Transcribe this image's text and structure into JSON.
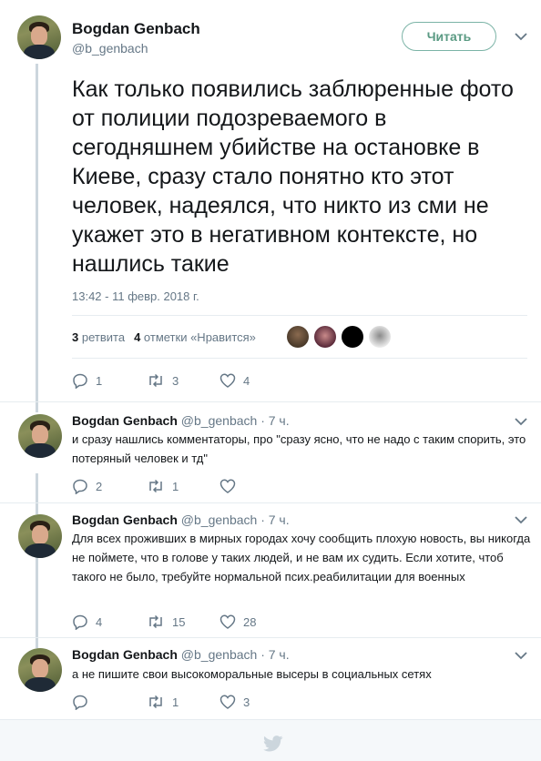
{
  "main_tweet": {
    "name": "Bogdan Genbach",
    "handle": "@b_genbach",
    "follow_label": "Читать",
    "text": "Как только появились заблюренные фото от полиции подозреваемого в сегодняшнем убийстве на остановке в Киеве, сразу стало понятно кто этот человек, надеялся, что никто из сми не укажет это в негативном контексте, но нашлись такие",
    "timestamp": "13:42 - 11 февр. 2018 г.",
    "retweets_count": "3",
    "retweets_label": "ретвита",
    "likes_count": "4",
    "likes_label": "отметки «Нравится»",
    "actions": {
      "replies": "1",
      "retweets": "3",
      "likes": "4"
    }
  },
  "replies": [
    {
      "name": "Bogdan Genbach",
      "handle": "@b_genbach",
      "time": "· 7 ч.",
      "text": "и сразу нашлись комментаторы, про \"сразу ясно, что не надо с таким спорить, это потеряный человек и тд\"",
      "replies": "2",
      "retweets": "1",
      "likes": ""
    },
    {
      "name": "Bogdan Genbach",
      "handle": "@b_genbach",
      "time": "· 7 ч.",
      "text": "Для всех проживших в мирных городах хочу сообщить плохую новость, вы никогда не поймете, что в голове у таких людей, и не вам их судить. Если хотите, чтоб такого не было, требуйте нормальной псих.реабилитации для военных",
      "replies": "4",
      "retweets": "15",
      "likes": "28"
    },
    {
      "name": "Bogdan Genbach",
      "handle": "@b_genbach",
      "time": "· 7 ч.",
      "text": "а не пишите свои высокоморальные высеры в социальных сетях",
      "replies": "",
      "retweets": "1",
      "likes": "3"
    }
  ],
  "icons": {
    "reply": "reply-icon",
    "retweet": "retweet-icon",
    "like": "heart-icon",
    "chevron": "chevron-down-icon",
    "logo": "twitter-bird-icon"
  },
  "colors": {
    "follow_accent": "#5a9a83",
    "muted": "#657786",
    "thread_line": "#ccd6dd",
    "logo": "#ccd6dd"
  }
}
